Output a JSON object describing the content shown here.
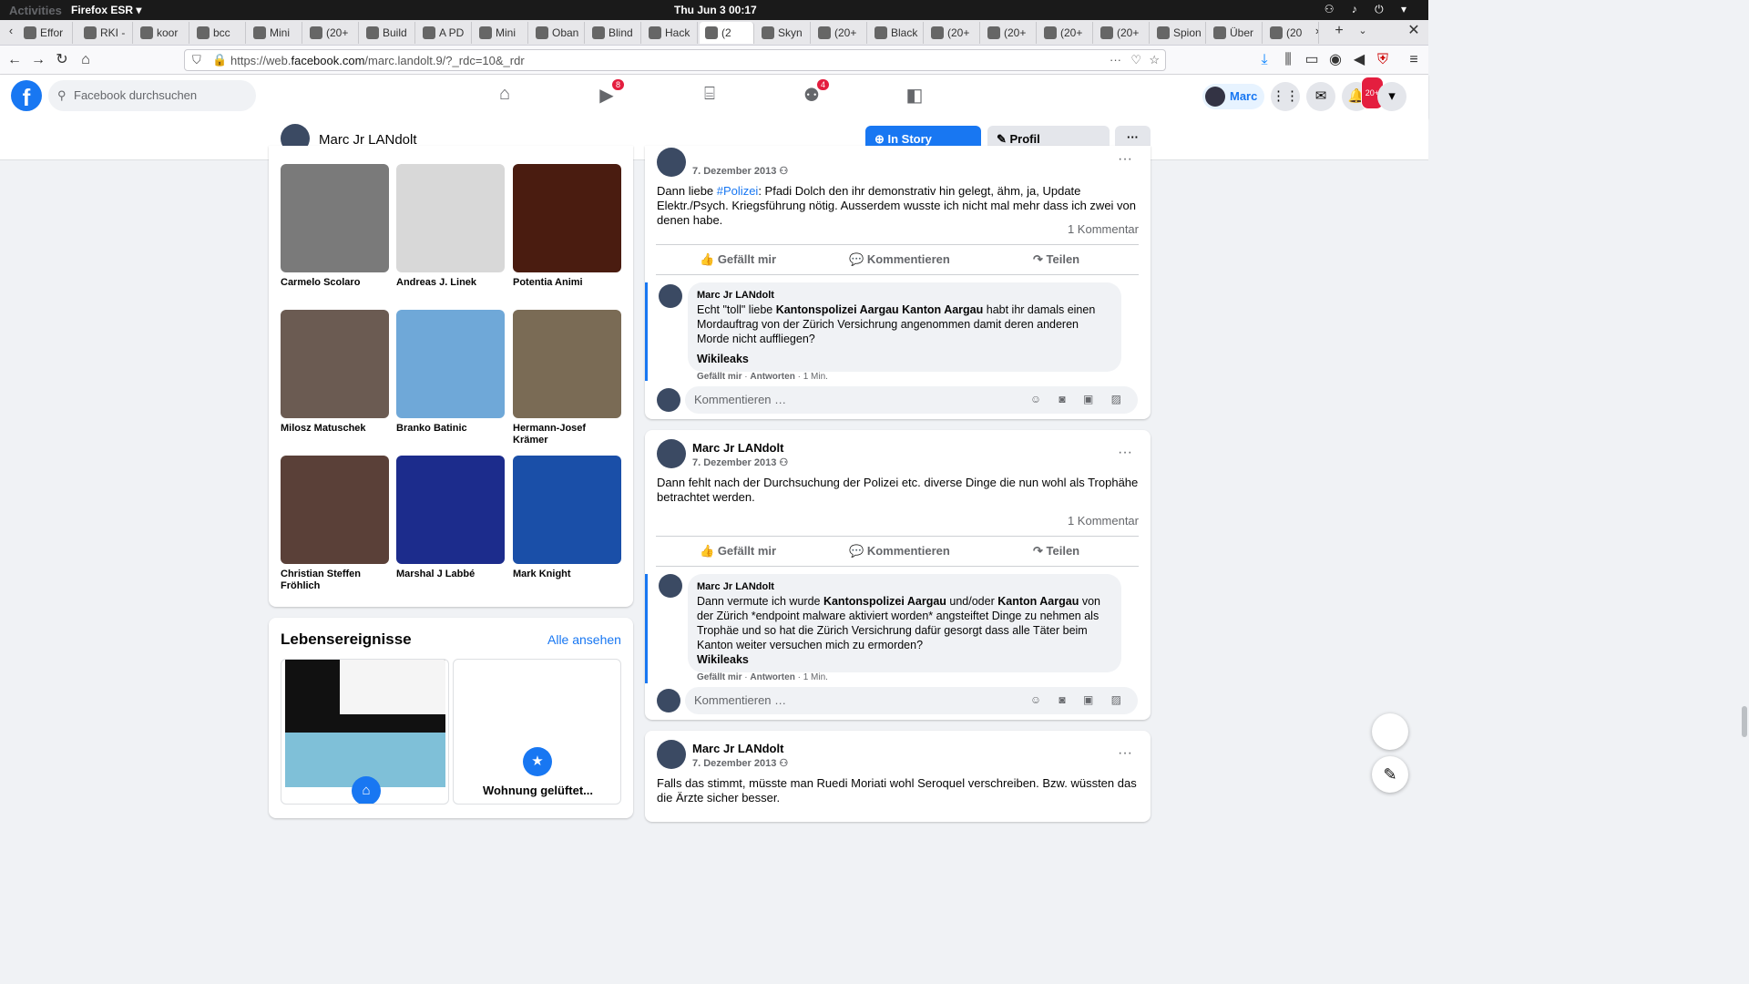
{
  "gnome": {
    "activities": "Activities",
    "app": "Firefox ESR",
    "clock": "Thu Jun 3  00:17"
  },
  "tabs": [
    "Effor",
    "RKI -",
    "koor",
    "bcc",
    "Mini",
    "(20+",
    "Build",
    "A PD",
    "Mini",
    "Oban",
    "Blind",
    "Hack",
    "(2",
    "Skyn",
    "(20+",
    "Black",
    "(20+",
    "(20+",
    "(20+",
    "(20+",
    "Spion",
    "Über",
    "(20"
  ],
  "browser": {
    "url_pre": "https://web.",
    "url_host": "facebook.com",
    "url_path": "/marc.landolt.9/?_rdc=10&_rdr"
  },
  "fb": {
    "search_placeholder": "Facebook durchsuchen",
    "badge_watch": "8",
    "badge_groups": "4",
    "me": "Marc",
    "badge_notif": "20+"
  },
  "profile": {
    "name": "Marc Jr LANdolt",
    "story_btn": "In Story posten",
    "edit_btn": "Profil bearbeiten",
    "more": "···"
  },
  "friends": [
    {
      "name": "Carmelo Scolaro",
      "color": "#7a7a7a"
    },
    {
      "name": "Andreas J. Linek",
      "color": "#d8d8d8"
    },
    {
      "name": "Potentia Animi",
      "color": "#4a1c10"
    },
    {
      "name": "Milosz Matuschek",
      "color": "#6b5b52"
    },
    {
      "name": "Branko Batinic",
      "color": "#6fa8d8"
    },
    {
      "name": "Hermann-Josef Krämer",
      "color": "#7a6b55"
    },
    {
      "name": "Christian Steffen Fröhlich",
      "color": "#5a4038"
    },
    {
      "name": "Marshal J Labbé",
      "color": "#1c2c8c"
    },
    {
      "name": "Mark Knight",
      "color": "#1a4fa8"
    }
  ],
  "life": {
    "title": "Lebensereignisse",
    "all": "Alle ansehen",
    "event2": "Wohnung gelüftet..."
  },
  "posts": [
    {
      "date": "7. Dezember 2013",
      "text_pre": "Dann liebe ",
      "hashtag": "#Polizei",
      "text_post": ": Pfadi Dolch den ihr demonstrativ hin gelegt, ähm, ja, Update Elektr./Psych. Kriegsführung nötig. Ausserdem wusste ich nicht mal mehr dass ich zwei von denen habe.",
      "count": "1 Kommentar",
      "comment_name": "Marc Jr LANdolt",
      "comment_text_1": "Echt \"toll\" liebe ",
      "comment_bold_1": "Kantonspolizei Aargau Kanton Aargau",
      "comment_text_2": " habt ihr damals einen Mordauftrag von der Zürich Versichrung angenommen damit deren anderen Morde nicht auffliegen?",
      "comment_bold_2": "Wikileaks"
    },
    {
      "name": "Marc Jr LANdolt",
      "date": "7. Dezember 2013",
      "text": "Dann fehlt nach der Durchsuchung der Polizei etc. diverse Dinge die nun wohl als Trophähe betrachtet werden.",
      "count": "1 Kommentar",
      "comment_name": "Marc Jr LANdolt",
      "comment_text_1": "Dann vermute ich wurde ",
      "comment_bold_1": "Kantonspolizei Aargau",
      "comment_text_2": " und/oder ",
      "comment_bold_2": "Kanton Aargau",
      "comment_text_3": " von der Zürich *endpoint malware aktiviert worden* angsteiftet Dinge zu nehmen als Trophäe und so hat die Zürich Versichrung dafür gesorgt dass alle Täter beim Kanton weiter versuchen mich zu ermorden?",
      "comment_bold_3": "Wikileaks"
    },
    {
      "name": "Marc Jr LANdolt",
      "date": "7. Dezember 2013",
      "text": "Falls das stimmt, müsste man Ruedi Moriati wohl Seroquel verschreiben. Bzw. wüssten das die Ärzte sicher besser."
    }
  ],
  "ui": {
    "like": "Gefällt mir",
    "comment": "Kommentieren",
    "share": "Teilen",
    "comment_placeholder": "Kommentieren …",
    "meta_like": "Gefällt mir",
    "meta_reply": "Antworten",
    "meta_time": "1 Min."
  }
}
